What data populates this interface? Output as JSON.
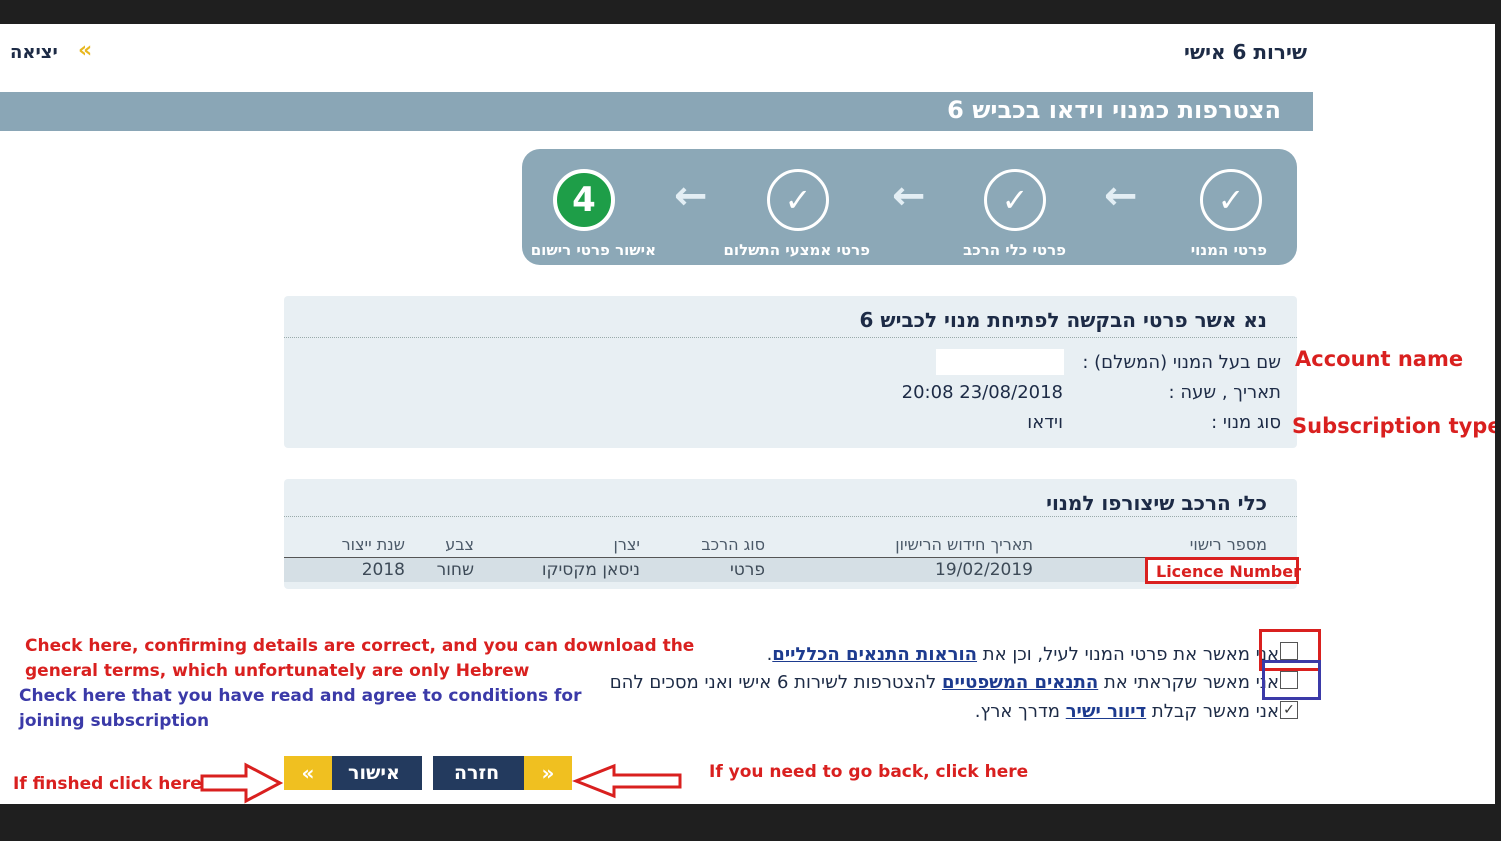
{
  "header": {
    "service_title": "שירות 6 אישי",
    "exit_label": "יציאה",
    "exit_chevron": "«"
  },
  "page_title": "הצטרפות כמנוי וידאו בכביש 6",
  "stepper": {
    "steps": [
      {
        "label": "פרטי המנוי",
        "state": "done",
        "mark": "✓"
      },
      {
        "label": "פרטי כלי הרכב",
        "state": "done",
        "mark": "✓"
      },
      {
        "label": "פרטי אמצעי התשלום",
        "state": "done",
        "mark": "✓"
      },
      {
        "label": "אישור פרטי רישום",
        "state": "current",
        "mark": "4"
      }
    ],
    "arrow": "←"
  },
  "details": {
    "title": "נא אשר פרטי הבקשה לפתיחת מנוי לכביש 6",
    "rows": [
      {
        "label": "שם בעל המנוי (המשלם) :",
        "value": ""
      },
      {
        "label": "תאריך , שעה :",
        "value": "20:08 23/08/2018"
      },
      {
        "label": "סוג מנוי :",
        "value": "וידאו"
      }
    ]
  },
  "vehicles": {
    "title": "כלי הרכב שיצורפו למנוי",
    "columns": [
      "מספר רישוי",
      "תאריך חידוש הרישיון",
      "סוג הרכב",
      "יצרן",
      "צבע",
      "שנת ייצור"
    ],
    "rows": [
      [
        "",
        "19/02/2019",
        "פרטי",
        "ניסאן מקסיקו",
        "שחור",
        "2018"
      ]
    ]
  },
  "checkboxes": [
    {
      "checked": false,
      "text_before": "אני מאשר את פרטי המנוי לעיל, וכן את ",
      "link": "הוראות התנאים הכלליים",
      "text_after": "."
    },
    {
      "checked": false,
      "text_before": "אני מאשר שקראתי את ",
      "link": "התנאים המשפטיים",
      "text_after": " להצטרפות לשירות 6 אישי ואני מסכים להם"
    },
    {
      "checked": true,
      "text_before": "אני מאשר קבלת ",
      "link": "דיוור ישיר",
      "text_after": " מדרך ארץ."
    }
  ],
  "buttons": {
    "back_label": "חזרה",
    "back_chevron": "»",
    "confirm_label": "אישור",
    "confirm_chevron": "«"
  },
  "annotations": {
    "account_name": "Account name",
    "subscription_type": "Subscription type",
    "licence_number": "Licence Number",
    "check_confirm_line1": "Check here, confirming details are correct, and you can download the",
    "check_confirm_line2": "general terms, which unfortunately are only Hebrew",
    "check_agree_line1": "Check here that you have read and agree to  conditions for",
    "check_agree_line2": "joining subscription",
    "finished": "If finshed click here",
    "go_back": "If you need to go back, click here"
  },
  "colors": {
    "navy": "#1d2b46",
    "steel": "#8aa6b6",
    "green": "#1e9e48",
    "gold": "#f0c020",
    "button": "#233a5e",
    "annotation_red": "#d9201f",
    "annotation_blue": "#3b3aa8"
  }
}
